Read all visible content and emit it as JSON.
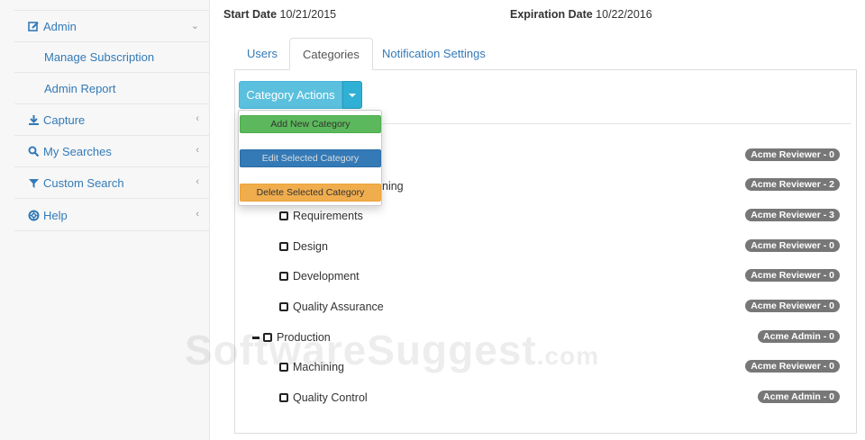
{
  "sidebar": {
    "admin": {
      "label": "Admin"
    },
    "sub_items": [
      {
        "label": "Manage Subscription"
      },
      {
        "label": "Admin Report"
      }
    ],
    "items": [
      {
        "label": "Capture"
      },
      {
        "label": "My Searches"
      },
      {
        "label": "Custom Search"
      },
      {
        "label": "Help"
      }
    ]
  },
  "header": {
    "start_label": "Start Date",
    "start_value": "10/21/2015",
    "exp_label": "Expiration Date",
    "exp_value": "10/22/2016"
  },
  "tabs": [
    {
      "label": "Users"
    },
    {
      "label": "Categories"
    },
    {
      "label": "Notification Settings"
    }
  ],
  "actions": {
    "button_label": "Category Actions",
    "menu": [
      {
        "label": "Add New Category"
      },
      {
        "label": "Edit Selected Category"
      },
      {
        "label": "Delete Selected Category"
      }
    ]
  },
  "tree": {
    "partial_label": "ning",
    "items": [
      {
        "label": "Requirements"
      },
      {
        "label": "Design"
      },
      {
        "label": "Development"
      },
      {
        "label": "Quality Assurance"
      },
      {
        "label": "Production"
      },
      {
        "label": "Machining"
      },
      {
        "label": "Quality Control"
      }
    ],
    "badges": [
      "Acme Reviewer - 0",
      "Acme Reviewer - 2",
      "Acme Reviewer - 3",
      "Acme Reviewer - 0",
      "Acme Reviewer - 0",
      "Acme Reviewer - 0",
      "Acme Admin - 0",
      "Acme Reviewer - 0",
      "Acme Admin - 0"
    ]
  },
  "watermark": {
    "main": "SoftwareSuggest",
    "suffix": ".com"
  }
}
